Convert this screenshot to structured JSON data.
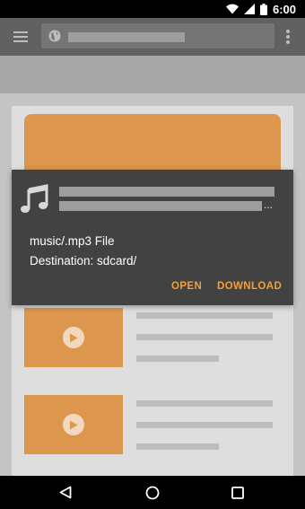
{
  "status_bar": {
    "time": "6:00",
    "icons": [
      "wifi-icon",
      "signal-icon",
      "battery-icon"
    ]
  },
  "toolbar": {
    "icons": [
      "menu-icon",
      "globe-icon",
      "overflow-menu-icon"
    ]
  },
  "download_prompt": {
    "icon": "music-note-icon",
    "title_ellipsis": "...",
    "file_name": "music/.mp3 File",
    "destination": "Destination: sdcard/",
    "open_label": "OPEN",
    "download_label": "DOWNLOAD"
  },
  "nav_bar": {
    "icons": [
      "back-icon",
      "home-icon",
      "recents-icon"
    ]
  },
  "colors": {
    "accent": "#f0a040",
    "placeholder_orange": "#dc964e",
    "dialog_bg": "#424242",
    "toolbar_bg": "#616161"
  }
}
